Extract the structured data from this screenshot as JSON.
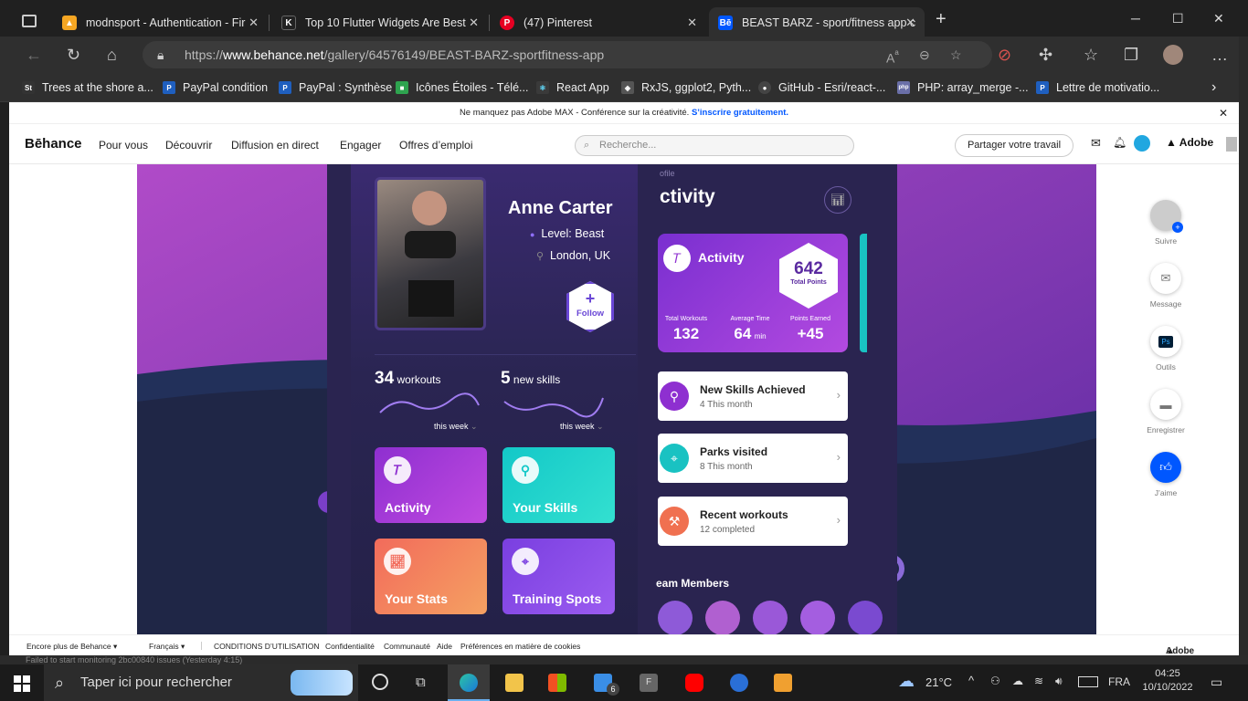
{
  "browser": {
    "tabs": [
      {
        "title": "modnsport - Authentication - Fir",
        "icon": "firebase-icon",
        "color": "#f5a623"
      },
      {
        "title": "Top 10 Flutter Widgets Are Best",
        "icon": "k-icon",
        "color": "#222222"
      },
      {
        "title": "(47) Pinterest",
        "icon": "pinterest-icon",
        "color": "#e60023"
      },
      {
        "title": "BEAST BARZ - sport/fitness app c",
        "icon": "behance-icon",
        "color": "#0057ff"
      }
    ],
    "url_prefix": "https://",
    "url_domain": "www.behance.net",
    "url_path": "/gallery/64576149/BEAST-BARZ-sportfitness-app",
    "bookmarks": [
      {
        "label": "Trees at the shore a...",
        "icon": "st-icon",
        "color": "#333333",
        "mark": "St"
      },
      {
        "label": "PayPal condition",
        "icon": "paypal-icon",
        "color": "#1f5fbf",
        "mark": "P"
      },
      {
        "label": "PayPal : Synthèse",
        "icon": "paypal-icon",
        "color": "#1f5fbf",
        "mark": "P"
      },
      {
        "label": "Icônes Étoiles - Télé...",
        "icon": "icons8-icon",
        "color": "#2ea44f",
        "mark": "■"
      },
      {
        "label": "React App",
        "icon": "react-icon",
        "color": "#3a3a3a",
        "mark": "⚛"
      },
      {
        "label": "RxJS, ggplot2, Pyth...",
        "icon": "rxjs-icon",
        "color": "#555555",
        "mark": "◈"
      },
      {
        "label": "GitHub - Esri/react-...",
        "icon": "github-icon",
        "color": "#444444",
        "mark": "●"
      },
      {
        "label": "PHP: array_merge -...",
        "icon": "php-icon",
        "color": "#6a6fa8",
        "mark": "php"
      },
      {
        "label": "Lettre de motivatio...",
        "icon": "p-icon",
        "color": "#1f5fbf",
        "mark": "P"
      }
    ]
  },
  "behance": {
    "notice_text": "Ne manquez pas Adobe MAX - Conférence sur la créativité.",
    "notice_link": "S’inscrire gratuitement.",
    "logo": "Bēhance",
    "nav": [
      "Pour vous",
      "Découvrir",
      "Diffusion en direct",
      "Engager",
      "Offres d’emploi"
    ],
    "search_placeholder": "Recherche...",
    "share_label": "Partager votre travail",
    "adobe_label": "Adobe",
    "sidebar": [
      {
        "label": "Suivre",
        "icon": "avatar-follow-icon"
      },
      {
        "label": "Message",
        "icon": "envelope-icon"
      },
      {
        "label": "Outils",
        "icon": "photoshop-icon"
      },
      {
        "label": "Enregistrer",
        "icon": "folder-icon"
      },
      {
        "label": "J’aime",
        "icon": "thumbs-up-icon"
      }
    ],
    "footer": [
      "Encore plus de Behance ▾",
      "Français ▾",
      "CONDITIONS D’UTILISATION",
      "Confidentialité",
      "Communauté",
      "Aide",
      "Préférences en matière de cookies"
    ]
  },
  "app": {
    "profile": {
      "name": "Anne Carter",
      "level": "Level: Beast",
      "location": "London, UK",
      "follow": "Follow",
      "workouts_count": "34",
      "workouts_label": "workouts",
      "skills_count": "5",
      "skills_label": "new skills",
      "period1": "this week",
      "period2": "this week"
    },
    "tiles": [
      {
        "label": "Activity",
        "from": "#8e2fd0",
        "to": "#c04ae0"
      },
      {
        "label": "Your Skills",
        "from": "#13c8c8",
        "to": "#33e0d0"
      },
      {
        "label": "Your Stats",
        "from": "#f26b5b",
        "to": "#f5a162"
      },
      {
        "label": "Training Spots",
        "from": "#7a3fe0",
        "to": "#9b5cf0"
      }
    ],
    "activity": {
      "subtitle": "ofile",
      "title": "ctivity",
      "card_title": "Activity",
      "points": "642",
      "points_label": "Total Points",
      "stats": [
        {
          "label": "Total Workouts",
          "value": "132",
          "unit": ""
        },
        {
          "label": "Average Time",
          "value": "64",
          "unit": "min"
        },
        {
          "label": "Points Earned",
          "value": "+45",
          "unit": ""
        }
      ],
      "list": [
        {
          "title": "New Skills Achieved",
          "sub": "4 This month",
          "color": "#8e2fd0"
        },
        {
          "title": "Parks visited",
          "sub": "8 This month",
          "color": "#19c2c2"
        },
        {
          "title": "Recent workouts",
          "sub": "12 completed",
          "color": "#f07050"
        }
      ],
      "team": "eam Members"
    }
  },
  "os": {
    "status_text": "Failed to start monitoring 2bc00840 issues (Yesterday 4:15)",
    "search_placeholder": "Taper ici pour rechercher",
    "weather": "21°C",
    "lang": "FRA",
    "time": "04:25",
    "date": "10/10/2022",
    "mail_badge": "6"
  }
}
